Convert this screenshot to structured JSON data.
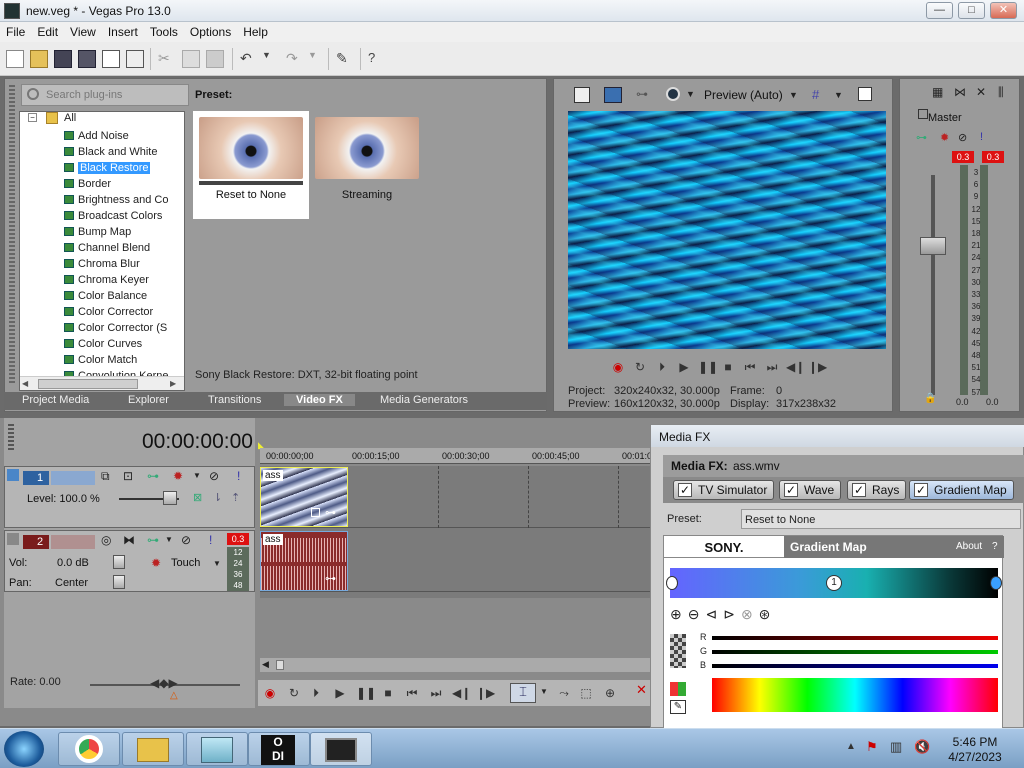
{
  "window": {
    "title": "new.veg * - Vegas Pro 13.0",
    "min": "—",
    "max": "□",
    "close": "✕"
  },
  "menu": [
    "File",
    "Edit",
    "View",
    "Insert",
    "Tools",
    "Options",
    "Help"
  ],
  "plugins": {
    "search_placeholder": "Search plug-ins",
    "root": "All",
    "items": [
      "Add Noise",
      "Black and White",
      "Black Restore",
      "Border",
      "Brightness and Co",
      "Broadcast Colors",
      "Bump Map",
      "Channel Blend",
      "Chroma Blur",
      "Chroma Keyer",
      "Color Balance",
      "Color Corrector",
      "Color Corrector (S",
      "Color Curves",
      "Color Match",
      "Convolution Kerne"
    ],
    "selected_index": 2,
    "preset_label": "Preset:",
    "presets": [
      "Reset to None",
      "Streaming"
    ],
    "status": "Sony Black Restore: DXT, 32-bit floating point"
  },
  "tabs": [
    "Project Media",
    "Explorer",
    "Transitions",
    "Video FX",
    "Media Generators"
  ],
  "active_tab": "Video FX",
  "preview": {
    "mode": "Preview (Auto)",
    "project_label": "Project:",
    "project": "320x240x32, 30.000p",
    "preview_label": "Preview:",
    "preview": "160x120x32, 30.000p",
    "frame_label": "Frame:",
    "frame": "0",
    "display_label": "Display:",
    "display": "317x238x32"
  },
  "master": {
    "title": "Master",
    "peak_l": "0.3",
    "peak_r": "0.3",
    "scale": [
      "3",
      "6",
      "9",
      "12",
      "15",
      "18",
      "21",
      "24",
      "27",
      "30",
      "33",
      "36",
      "39",
      "42",
      "45",
      "48",
      "51",
      "54",
      "57"
    ],
    "out_l": "0.0",
    "out_r": "0.0"
  },
  "timeline": {
    "timecode": "00:00:00:00",
    "ruler": [
      "00:00:00;00",
      "00:00:15;00",
      "00:00:30;00",
      "00:00:45;00",
      "00:01:0"
    ],
    "track1": {
      "num": "1",
      "level": "Level: 100.0 %"
    },
    "track2": {
      "num": "2",
      "vol_label": "Vol:",
      "vol": "0.0 dB",
      "pan_label": "Pan:",
      "pan": "Center",
      "mode": "Touch",
      "peak": "0.3",
      "meter": [
        "12",
        "24",
        "36",
        "48"
      ]
    },
    "clip_name": "ass",
    "rate": "Rate: 0.00"
  },
  "mediafx": {
    "window_title": "Media FX",
    "label": "Media FX:",
    "file": "ass.wmv",
    "chain": [
      "TV Simulator",
      "Wave",
      "Rays",
      "Gradient Map"
    ],
    "preset_label": "Preset:",
    "preset": "Reset to None",
    "brand": "SONY.",
    "effect": "Gradient Map",
    "about": "About",
    "help": "?",
    "marker": "1",
    "channels": [
      "R",
      "G",
      "B"
    ]
  },
  "taskbar": {
    "time": "5:46 PM",
    "date": "4/27/2023"
  }
}
